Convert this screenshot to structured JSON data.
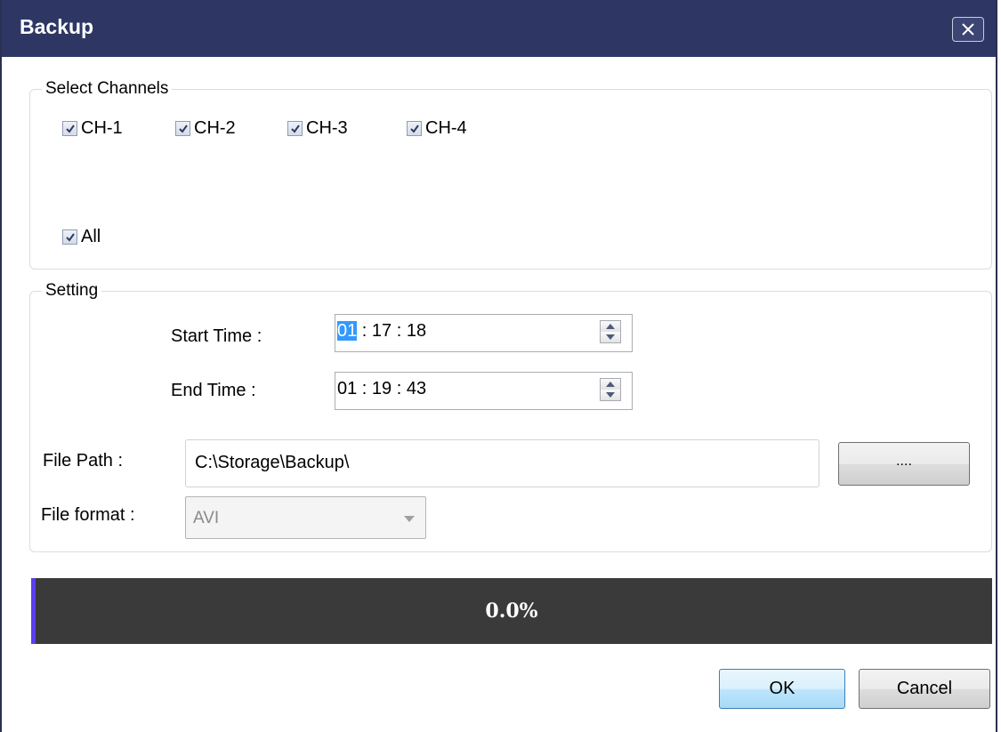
{
  "window": {
    "title": "Backup",
    "close_icon": "close-icon"
  },
  "channels": {
    "group_label": "Select Channels",
    "items": [
      {
        "label": "CH-1",
        "checked": true
      },
      {
        "label": "CH-2",
        "checked": true
      },
      {
        "label": "CH-3",
        "checked": true
      },
      {
        "label": "CH-4",
        "checked": true
      }
    ],
    "all": {
      "label": "All",
      "checked": true
    }
  },
  "setting": {
    "group_label": "Setting",
    "start_time": {
      "label": "Start Time :",
      "hour": "01",
      "rest": " : 17 : 18",
      "selected_segment": "hour"
    },
    "end_time": {
      "label": "End Time :",
      "value": "01 : 19 : 43"
    },
    "file_path": {
      "label": "File Path :",
      "value": "C:\\Storage\\Backup\\",
      "browse_label": "...."
    },
    "file_format": {
      "label": "File format :",
      "selected": "AVI",
      "enabled": false
    }
  },
  "progress": {
    "percent": 0.0,
    "text": "0.0%",
    "track_color": "#3a3a3a",
    "fill_color": "#5b3ff0"
  },
  "buttons": {
    "ok_label": "OK",
    "cancel_label": "Cancel"
  },
  "colors": {
    "titlebar": "#2e3764",
    "selection": "#3399ff"
  }
}
